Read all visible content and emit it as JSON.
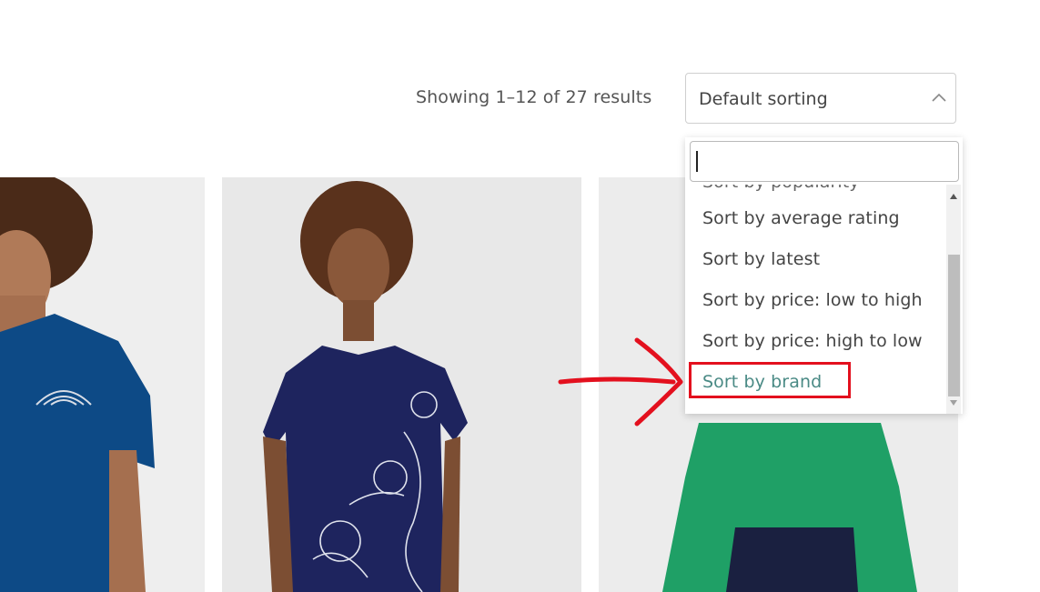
{
  "toolbar": {
    "result_count": "Showing 1–12 of 27 results",
    "sort_value": "Default sorting",
    "sort_chevron_icon": "chevron-up-icon"
  },
  "dropdown": {
    "search_value": "",
    "options": [
      {
        "label": "Sort by popularity"
      },
      {
        "label": "Sort by average rating"
      },
      {
        "label": "Sort by latest"
      },
      {
        "label": "Sort by price: low to high"
      },
      {
        "label": "Sort by price: high to low"
      },
      {
        "label": "Sort by brand"
      }
    ],
    "highlighted_option_index": 5
  },
  "annotation": {
    "arrow_icon": "hand-drawn-arrow-icon",
    "color": "#e3101e"
  },
  "colors": {
    "highlight_text": "#4a8a85",
    "shirt_1": "#0d4a86",
    "shirt_2": "#1e245e",
    "shirt_3": "#1fa066"
  }
}
